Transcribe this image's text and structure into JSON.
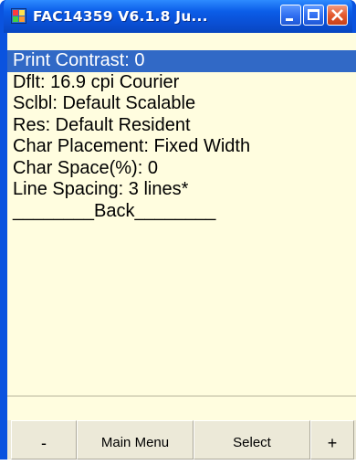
{
  "window": {
    "title": "FAC14359 V6.1.8 Ju...",
    "icon": "app-icon",
    "controls": [
      "minimize",
      "maximize",
      "close"
    ]
  },
  "menu": {
    "items": [
      {
        "label": "Print Contrast: 0",
        "selected": true
      },
      {
        "label": "Dflt: 16.9 cpi Courier",
        "selected": false
      },
      {
        "label": "Sclbl: Default Scalable",
        "selected": false
      },
      {
        "label": "Res: Default Resident",
        "selected": false
      },
      {
        "label": "Char Placement: Fixed Width",
        "selected": false
      },
      {
        "label": "Char Space(%): 0",
        "selected": false
      },
      {
        "label": "Line Spacing: 3 lines*",
        "selected": false
      },
      {
        "label": "________Back________",
        "selected": false
      }
    ]
  },
  "softkeys": {
    "minus": "-",
    "main_menu": "Main Menu",
    "select": "Select",
    "plus": "+"
  },
  "colors": {
    "title_bar": "#0a53df",
    "client_bg": "#fffddf",
    "selection": "#3169c6",
    "button_face": "#ece9d8"
  }
}
